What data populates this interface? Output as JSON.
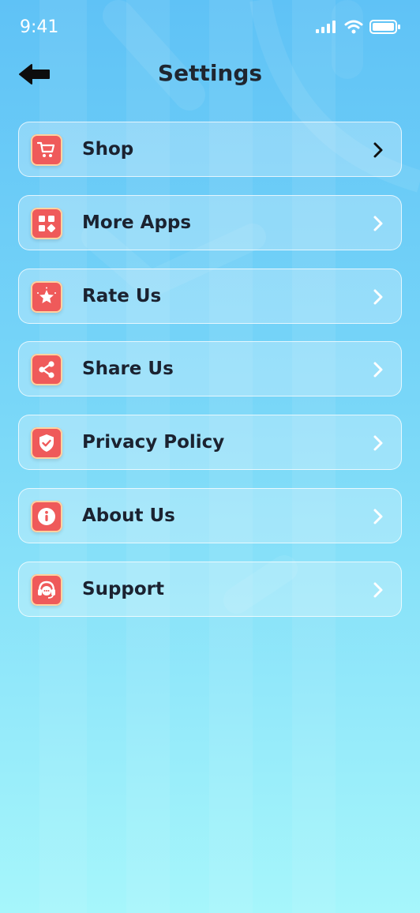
{
  "status_bar": {
    "time": "9:41"
  },
  "header": {
    "title": "Settings"
  },
  "menu": {
    "items": [
      {
        "label": "Shop",
        "icon": "cart-icon"
      },
      {
        "label": "More Apps",
        "icon": "apps-grid-icon"
      },
      {
        "label": "Rate Us",
        "icon": "star-icon"
      },
      {
        "label": "Share Us",
        "icon": "share-icon"
      },
      {
        "label": "Privacy Policy",
        "icon": "shield-check-icon"
      },
      {
        "label": "About Us",
        "icon": "info-icon"
      },
      {
        "label": "Support",
        "icon": "headset-icon"
      }
    ]
  },
  "colors": {
    "accent": "#ef5a5a",
    "title_text": "#1f2630",
    "background_top": "#5fc2f6",
    "background_bottom": "#a6f6fb"
  }
}
